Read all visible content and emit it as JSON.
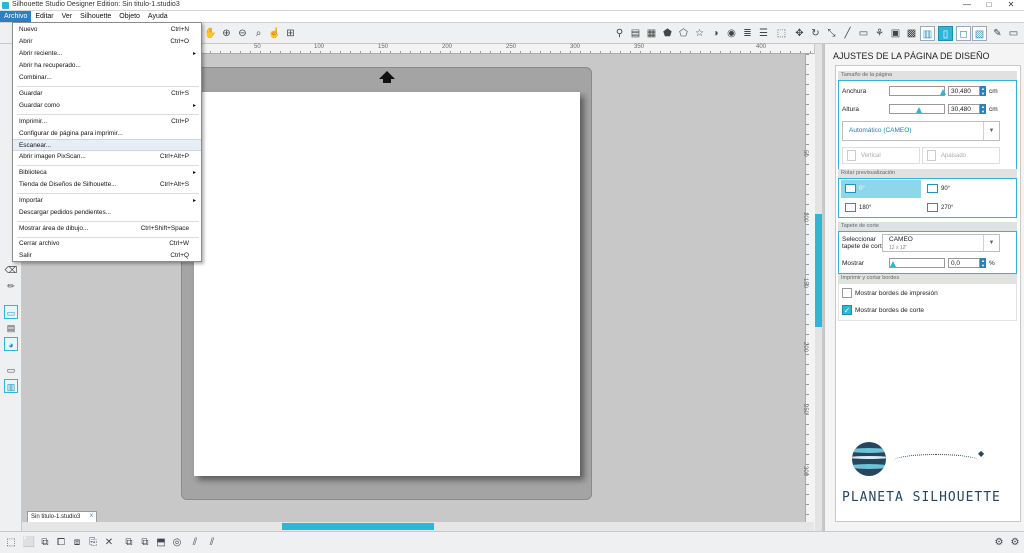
{
  "window": {
    "title": "Silhouette Studio Designer Edition: Sin titulo-1.studio3",
    "minimize": "—",
    "maximize": "□",
    "close": "✕"
  },
  "menubar": {
    "items": [
      {
        "label": "Archivo"
      },
      {
        "label": "Editar"
      },
      {
        "label": "Ver"
      },
      {
        "label": "Silhouette"
      },
      {
        "label": "Objeto"
      },
      {
        "label": "Ayuda"
      }
    ]
  },
  "archivo_menu": {
    "items": [
      {
        "label": "Nuevo",
        "shortcut": "Ctrl+N"
      },
      {
        "label": "Abrir",
        "shortcut": "Ctrl+O"
      },
      {
        "label": "Abrir reciente...",
        "submenu": "▸"
      },
      {
        "label": "Abrir ha recuperado..."
      },
      {
        "label": "Combinar..."
      },
      {
        "label": "Guardar",
        "shortcut": "Ctrl+S"
      },
      {
        "label": "Guardar como",
        "submenu": "▸"
      },
      {
        "label": "Imprimir...",
        "shortcut": "Ctrl+P"
      },
      {
        "label": "Configurar de página para imprimir..."
      },
      {
        "label": "Escanear..."
      },
      {
        "label": "Abrir imagen PixScan...",
        "shortcut": "Ctrl+Alt+P"
      },
      {
        "label": "Biblioteca",
        "submenu": "▸"
      },
      {
        "label": "Tienda de Diseños de Silhouette...",
        "shortcut": "Ctrl+Alt+S"
      },
      {
        "label": "Importar",
        "submenu": "▸"
      },
      {
        "label": "Descargar pedidos pendientes..."
      },
      {
        "label": "Mostrar área de dibujo...",
        "shortcut": "Ctrl+Shift+Space"
      },
      {
        "label": "Cerrar archivo",
        "shortcut": "Ctrl+W"
      },
      {
        "label": "Salir",
        "shortcut": "Ctrl+Q"
      }
    ]
  },
  "ruler": {
    "top_ticks": [
      "50",
      "100",
      "150",
      "200",
      "250",
      "300",
      "350",
      "400"
    ],
    "right_ticks": [
      "50",
      "100",
      "150",
      "200",
      "250",
      "300"
    ]
  },
  "document_tab": {
    "label": "Sin titulo-1.studio3",
    "close": "x"
  },
  "panel": {
    "title": "AJUSTES DE LA PÁGINA DE DISEÑO",
    "page_size": {
      "header": "Tamaño de la página",
      "width_label": "Anchura",
      "width_value": "30,480",
      "height_label": "Altura",
      "height_value": "30,480",
      "unit": "cm",
      "size_preset": "Automático (CAMEO)",
      "vertical_label": "Vertical",
      "horizontal_label": "Apaisado"
    },
    "rotate": {
      "header": "Rotar previsualización",
      "options": [
        "0°",
        "90°",
        "180°",
        "270°"
      ]
    },
    "cutting_mat": {
      "header": "Tapete de corte",
      "select_label_1": "Seleccionar",
      "select_label_2": "tapete de corte",
      "mat_name": "CAMEO",
      "mat_size": "12 x 12\"",
      "show_label": "Mostrar",
      "show_value": "0,0",
      "show_unit": "%"
    },
    "borders": {
      "header": "Imprimir y cortar bordes",
      "print_borders": "Mostrar bordes de impresión",
      "cut_borders": "Mostrar bordes de corte",
      "print_checked": false,
      "cut_checked": true
    }
  },
  "logo": {
    "text": "PLANETA SILHOUETTE"
  }
}
